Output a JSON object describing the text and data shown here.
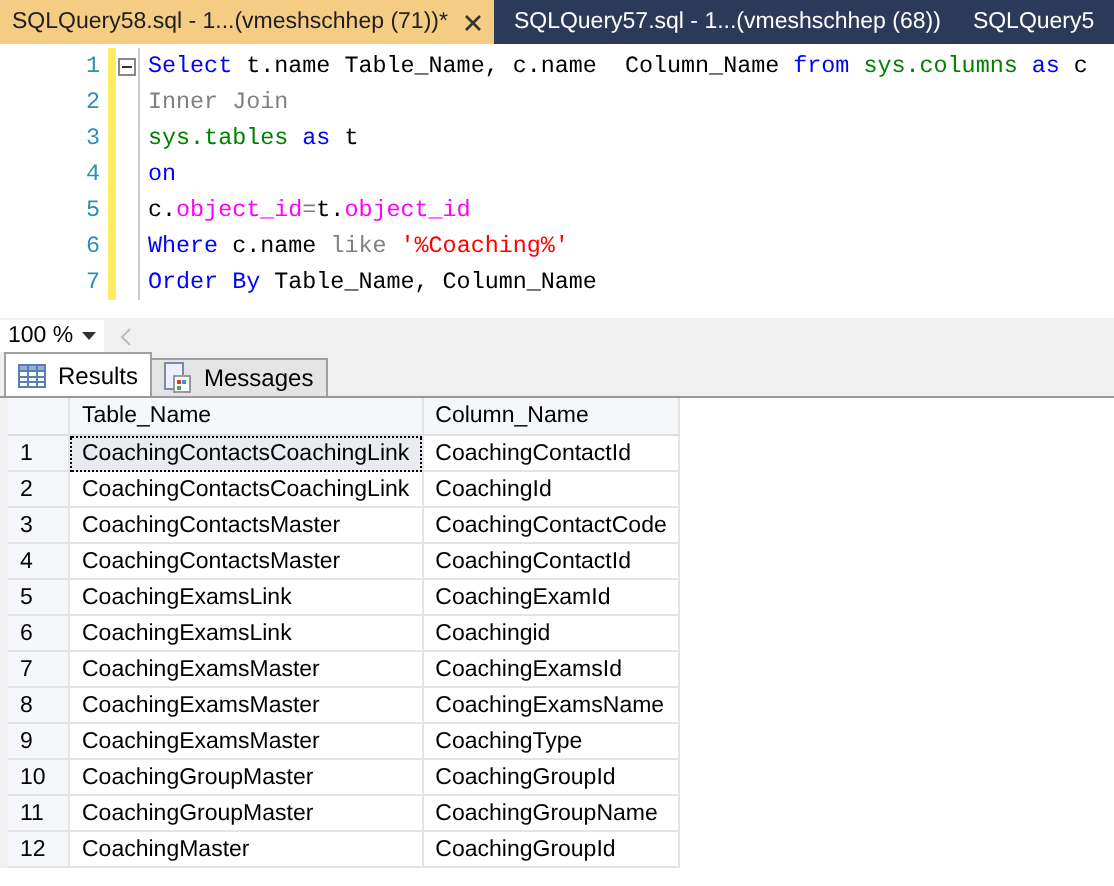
{
  "tabs": [
    {
      "label": "SQLQuery58.sql - 1...(vmeshschhep (71))*",
      "selected": true
    },
    {
      "label": "SQLQuery57.sql - 1...(vmeshschhep (68))",
      "selected": false
    },
    {
      "label": "SQLQuery5",
      "selected": false
    }
  ],
  "editor": {
    "lines": [
      {
        "number": "1",
        "tokens": [
          {
            "kind": "keyword",
            "text": "Select"
          },
          {
            "kind": "plain",
            "text": " t.name Table_Name, c.name  Column_Name "
          },
          {
            "kind": "keyword",
            "text": "from"
          },
          {
            "kind": "system",
            "text": " sys.columns"
          },
          {
            "kind": "keyword",
            "text": " as"
          },
          {
            "kind": "plain",
            "text": " c"
          }
        ]
      },
      {
        "number": "2",
        "tokens": [
          {
            "kind": "operator",
            "text": "Inner Join"
          }
        ]
      },
      {
        "number": "3",
        "tokens": [
          {
            "kind": "system",
            "text": "sys.tables"
          },
          {
            "kind": "keyword",
            "text": " as"
          },
          {
            "kind": "plain",
            "text": " t"
          }
        ]
      },
      {
        "number": "4",
        "tokens": [
          {
            "kind": "keyword",
            "text": "on"
          }
        ]
      },
      {
        "number": "5",
        "tokens": [
          {
            "kind": "plain",
            "text": "c."
          },
          {
            "kind": "function",
            "text": "object_id"
          },
          {
            "kind": "operator",
            "text": "="
          },
          {
            "kind": "plain",
            "text": "t."
          },
          {
            "kind": "function",
            "text": "object_id"
          }
        ]
      },
      {
        "number": "6",
        "tokens": [
          {
            "kind": "keyword",
            "text": "Where"
          },
          {
            "kind": "plain",
            "text": " c.name "
          },
          {
            "kind": "operator",
            "text": "like"
          },
          {
            "kind": "string",
            "text": " '%Coaching%'"
          }
        ]
      },
      {
        "number": "7",
        "tokens": [
          {
            "kind": "keyword",
            "text": "Order By"
          },
          {
            "kind": "plain",
            "text": " Table_Name, Column_Name"
          }
        ]
      }
    ]
  },
  "zoom": {
    "value": "100 %"
  },
  "result_tabs": [
    {
      "label": "Results",
      "selected": true
    },
    {
      "label": "Messages",
      "selected": false
    }
  ],
  "table": {
    "columns": [
      "Table_Name",
      "Column_Name"
    ],
    "rows": [
      {
        "number": "1",
        "cells": [
          "CoachingContactsCoachingLink",
          "CoachingContactId"
        ],
        "selected": true
      },
      {
        "number": "2",
        "cells": [
          "CoachingContactsCoachingLink",
          "CoachingId"
        ],
        "selected": false
      },
      {
        "number": "3",
        "cells": [
          "CoachingContactsMaster",
          "CoachingContactCode"
        ],
        "selected": false
      },
      {
        "number": "4",
        "cells": [
          "CoachingContactsMaster",
          "CoachingContactId"
        ],
        "selected": false
      },
      {
        "number": "5",
        "cells": [
          "CoachingExamsLink",
          "CoachingExamId"
        ],
        "selected": false
      },
      {
        "number": "6",
        "cells": [
          "CoachingExamsLink",
          "Coachingid"
        ],
        "selected": false
      },
      {
        "number": "7",
        "cells": [
          "CoachingExamsMaster",
          "CoachingExamsId"
        ],
        "selected": false
      },
      {
        "number": "8",
        "cells": [
          "CoachingExamsMaster",
          "CoachingExamsName"
        ],
        "selected": false
      },
      {
        "number": "9",
        "cells": [
          "CoachingExamsMaster",
          "CoachingType"
        ],
        "selected": false
      },
      {
        "number": "10",
        "cells": [
          "CoachingGroupMaster",
          "CoachingGroupId"
        ],
        "selected": false
      },
      {
        "number": "11",
        "cells": [
          "CoachingGroupMaster",
          "CoachingGroupName"
        ],
        "selected": false
      },
      {
        "number": "12",
        "cells": [
          "CoachingMaster",
          "CoachingGroupId"
        ],
        "selected": false
      }
    ]
  }
}
